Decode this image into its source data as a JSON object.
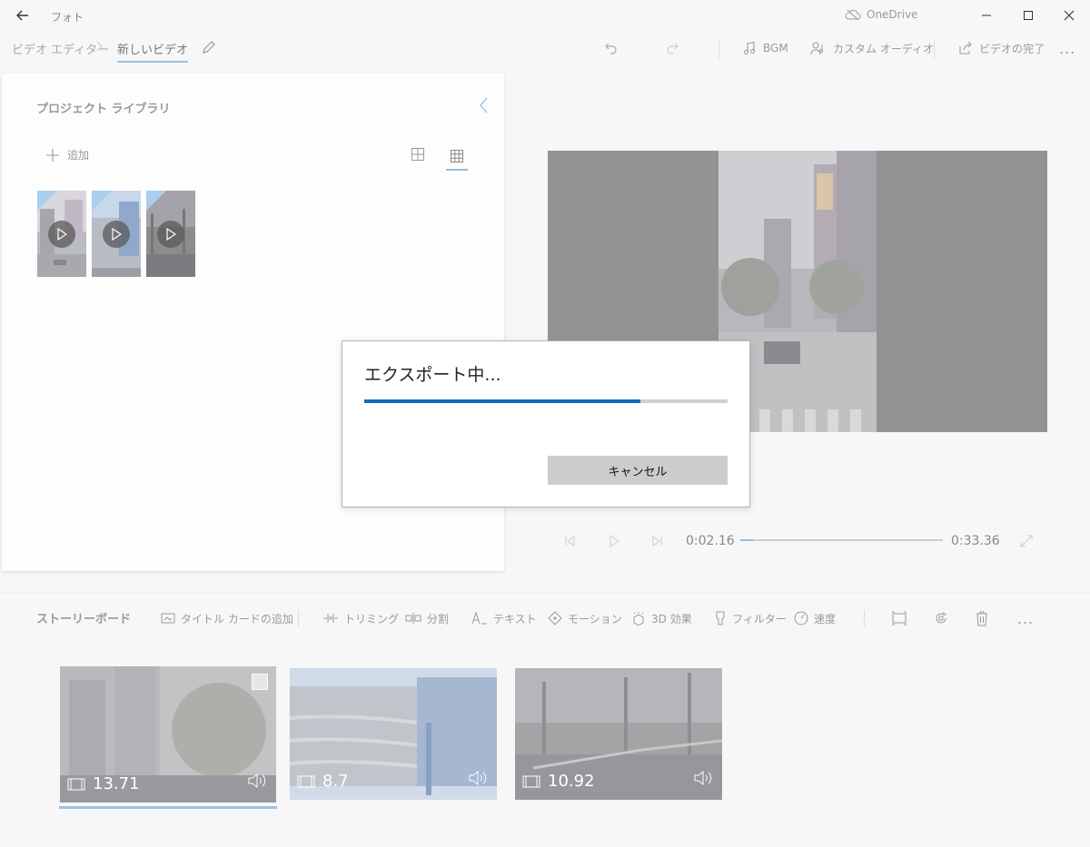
{
  "window": {
    "app_title": "フォト",
    "onedrive_label": "OneDrive"
  },
  "toolbar": {
    "breadcrumb_root": "ビデオ エディター",
    "breadcrumb_sep": ">",
    "breadcrumb_current": "新しいビデオ",
    "bgm_label": "BGM",
    "custom_audio_label": "カスタム オーディオ",
    "finish_label": "ビデオの完了",
    "more_label": "..."
  },
  "library": {
    "title": "プロジェクト ライブラリ",
    "add_label": "追加",
    "items": [
      {
        "name": "library-item-1"
      },
      {
        "name": "library-item-2"
      },
      {
        "name": "library-item-3"
      }
    ]
  },
  "playback": {
    "current_time": "0:02.16",
    "total_time": "0:33.36",
    "progress": 0.0648
  },
  "storyboard": {
    "title": "ストーリーボード",
    "add_title_card": "タイトル カードの追加",
    "trim": "トリミング",
    "split": "分割",
    "text": "テキスト",
    "motion": "モーション",
    "effects_3d": "3D 効果",
    "filter": "フィルター",
    "speed": "速度",
    "more": "...",
    "clips": [
      {
        "duration": "13.71",
        "selected": true
      },
      {
        "duration": "8.7",
        "selected": false
      },
      {
        "duration": "10.92",
        "selected": false
      }
    ]
  },
  "dialog": {
    "title": "エクスポート中...",
    "progress": 0.76,
    "cancel_label": "キャンセル"
  },
  "colors": {
    "accent": "#0f6cbd",
    "accent_light": "#9cc3e5",
    "preview_bg": "#939393"
  }
}
